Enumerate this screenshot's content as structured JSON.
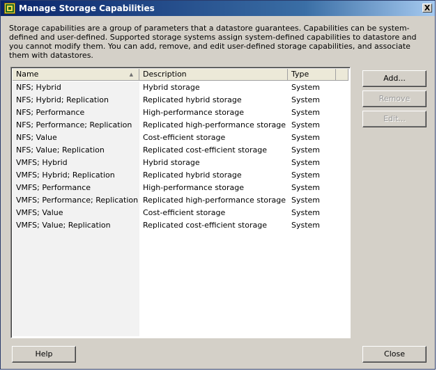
{
  "window": {
    "title": "Manage Storage Capabilities",
    "close_glyph": "X"
  },
  "intro_text": "Storage capabilities are a group of parameters that a datastore guarantees. Capabilities can be system-defined and user-defined. Supported storage systems assign system-defined capabilities to datastore and you cannot modify them. You can add, remove, and edit user-defined storage capabilities, and associate them with datastores.",
  "table": {
    "columns": [
      "Name",
      "Description",
      "Type"
    ],
    "sort_indicator": "ascending",
    "rows": [
      {
        "name": "NFS; Hybrid",
        "description": "Hybrid storage",
        "type": "System"
      },
      {
        "name": "NFS; Hybrid; Replication",
        "description": "Replicated hybrid storage",
        "type": "System"
      },
      {
        "name": "NFS; Performance",
        "description": "High-performance storage",
        "type": "System"
      },
      {
        "name": "NFS; Performance; Replication",
        "description": "Replicated high-performance storage",
        "type": "System"
      },
      {
        "name": "NFS; Value",
        "description": "Cost-efficient storage",
        "type": "System"
      },
      {
        "name": "NFS; Value; Replication",
        "description": "Replicated cost-efficient storage",
        "type": "System"
      },
      {
        "name": "VMFS; Hybrid",
        "description": "Hybrid storage",
        "type": "System"
      },
      {
        "name": "VMFS; Hybrid; Replication",
        "description": "Replicated hybrid storage",
        "type": "System"
      },
      {
        "name": "VMFS; Performance",
        "description": "High-performance storage",
        "type": "System"
      },
      {
        "name": "VMFS; Performance; Replication",
        "description": "Replicated high-performance storage",
        "type": "System"
      },
      {
        "name": "VMFS; Value",
        "description": "Cost-efficient storage",
        "type": "System"
      },
      {
        "name": "VMFS; Value; Replication",
        "description": "Replicated cost-efficient storage",
        "type": "System"
      }
    ]
  },
  "buttons": {
    "add": "Add...",
    "remove": "Remove",
    "edit": "Edit...",
    "help": "Help",
    "close": "Close"
  },
  "icons": {
    "app": "vsphere-storage-icon",
    "close": "close-icon"
  },
  "colors": {
    "titlebar_start": "#0a246a",
    "titlebar_end": "#a6caf0",
    "dialog_bg": "#d4d0c8",
    "disabled_text": "#9a9a9a"
  }
}
